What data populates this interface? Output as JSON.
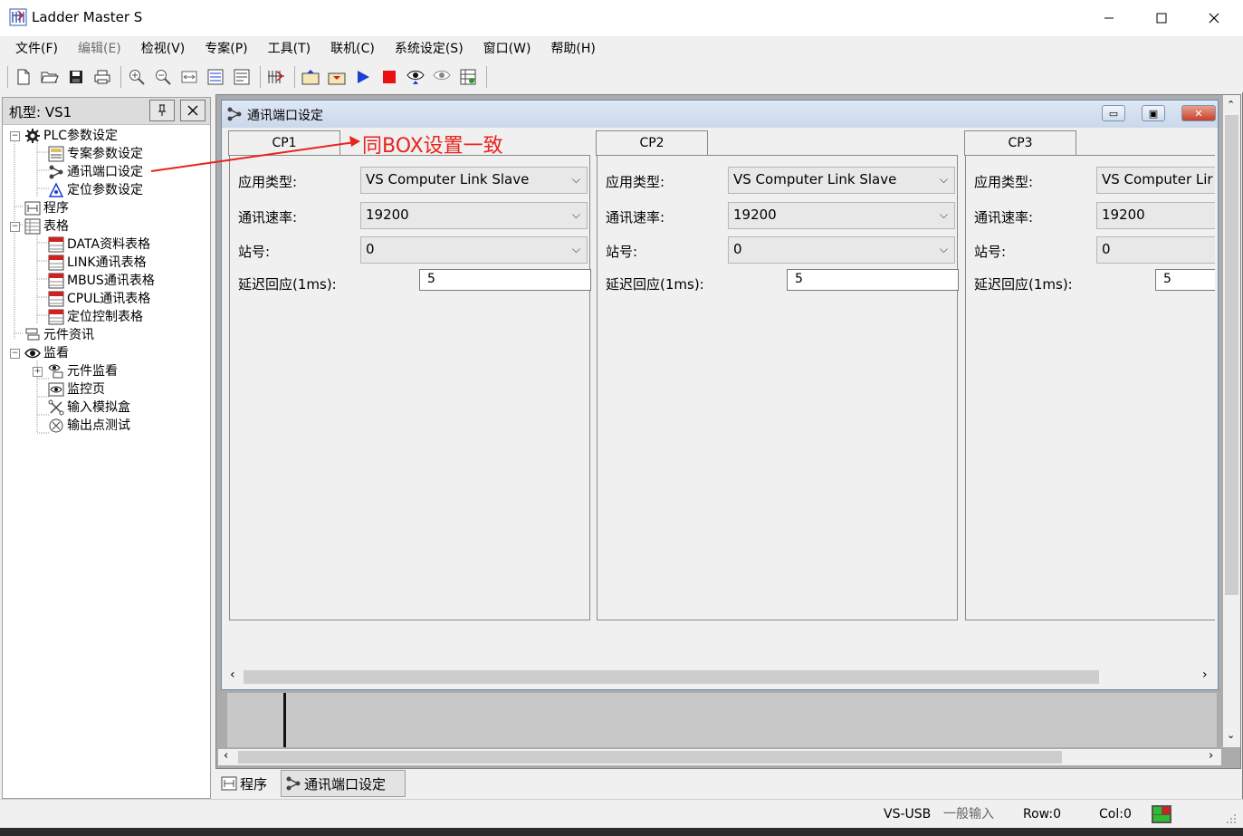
{
  "window": {
    "title": "Ladder Master S"
  },
  "menu": {
    "items": [
      {
        "label": "文件(F)",
        "disabled": false
      },
      {
        "label": "编辑(E)",
        "disabled": true
      },
      {
        "label": "检视(V)",
        "disabled": false
      },
      {
        "label": "专案(P)",
        "disabled": false
      },
      {
        "label": "工具(T)",
        "disabled": false
      },
      {
        "label": "联机(C)",
        "disabled": false
      },
      {
        "label": "系统设定(S)",
        "disabled": false
      },
      {
        "label": "窗口(W)",
        "disabled": false
      },
      {
        "label": "帮助(H)",
        "disabled": false
      }
    ]
  },
  "left_panel": {
    "title": "机型: VS1",
    "tree": {
      "plc_params": "PLC参数设定",
      "project_params": "专案参数设定",
      "comm_port": "通讯端口设定",
      "position_params": "定位参数设定",
      "program": "程序",
      "tables": "表格",
      "data_table": "DATA资料表格",
      "link_table": "LINK通讯表格",
      "mbus_table": "MBUS通讯表格",
      "cpul_table": "CPUL通讯表格",
      "position_table": "定位控制表格",
      "component_info": "元件资讯",
      "monitor": "监看",
      "component_monitor": "元件监看",
      "monitor_page": "监控页",
      "input_sim": "输入模拟盒",
      "output_test": "输出点测试"
    }
  },
  "child_window": {
    "title": "通讯端口设定",
    "annotation": "同BOX设置一致",
    "labels": {
      "app_type": "应用类型:",
      "baud": "通讯速率:",
      "station": "站号:",
      "delay": "延迟回应(1ms):"
    },
    "ports": [
      {
        "tab": "CP1",
        "app_type": "VS Computer Link Slave",
        "baud": "19200",
        "station": "0",
        "delay": "5"
      },
      {
        "tab": "CP2",
        "app_type": "VS Computer Link Slave",
        "baud": "19200",
        "station": "0",
        "delay": "5"
      },
      {
        "tab": "CP3",
        "app_type": "VS Computer Lir",
        "baud": "19200",
        "station": "0",
        "delay": "5"
      }
    ]
  },
  "bottom_tabs": [
    {
      "label": "程序"
    },
    {
      "label": "通讯端口设定"
    }
  ],
  "status": {
    "connection": "VS-USB",
    "mode": "一般输入",
    "row": "Row:0",
    "col": "Col:0"
  },
  "colors": {
    "annotation": "#e8231e",
    "run_button": "#1a3fd6",
    "stop_button": "#e81010",
    "child_title": "#cad8ea"
  }
}
